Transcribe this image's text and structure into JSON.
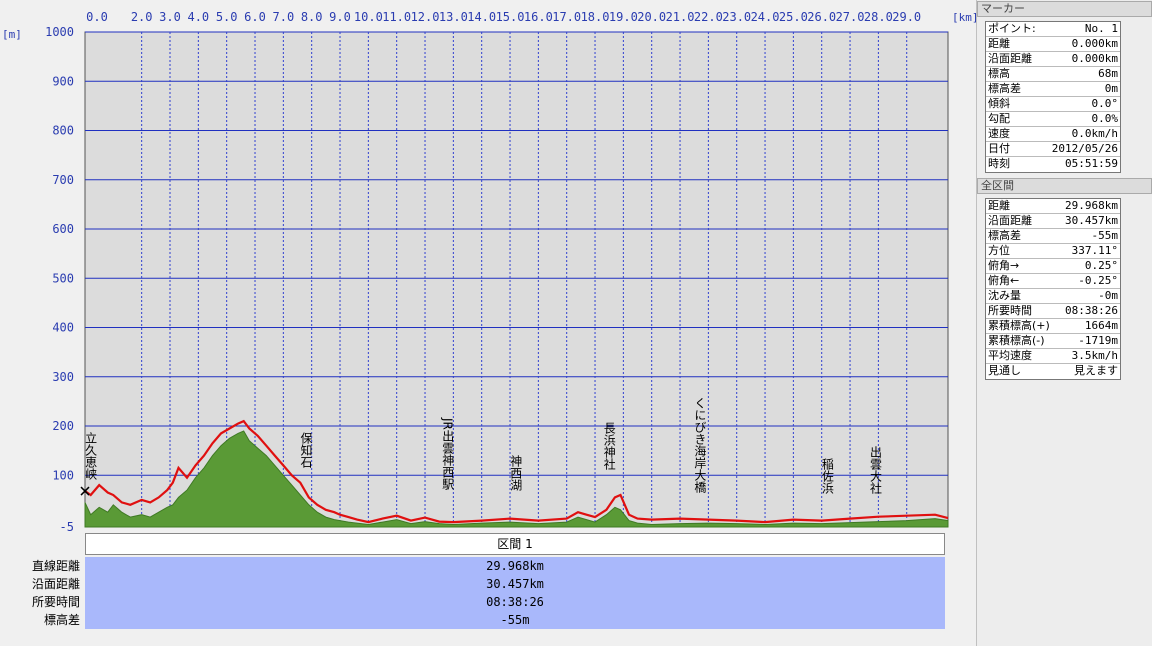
{
  "chart_data": {
    "type": "area",
    "title": "",
    "x_unit": "[km]",
    "y_unit": "[m]",
    "xlim": [
      0,
      30.457
    ],
    "ylim": [
      -5,
      1000
    ],
    "x_ticks": [
      "0.0",
      "2.0",
      "3.0",
      "4.0",
      "5.0",
      "6.0",
      "7.0",
      "8.0",
      "9.0",
      "10.0",
      "11.0",
      "12.0",
      "13.0",
      "14.0",
      "15.0",
      "16.0",
      "17.0",
      "18.0",
      "19.0",
      "20.0",
      "21.0",
      "22.0",
      "23.0",
      "24.0",
      "25.0",
      "26.0",
      "27.0",
      "28.0",
      "29.0"
    ],
    "y_ticks": [
      "1000",
      "900",
      "800",
      "700",
      "600",
      "500",
      "400",
      "300",
      "200",
      "100",
      "-5"
    ],
    "grid": true,
    "series": [
      {
        "color": "#5a9a36",
        "x": [
          0.0,
          0.2,
          0.5,
          0.8,
          1.0,
          1.3,
          1.6,
          2.0,
          2.3,
          2.6,
          2.9,
          3.1,
          3.3,
          3.6,
          3.9,
          4.2,
          4.5,
          4.8,
          5.1,
          5.4,
          5.6,
          5.8,
          6.1,
          6.4,
          6.7,
          7.0,
          7.3,
          7.6,
          7.9,
          8.2,
          8.5,
          8.8,
          9.0,
          9.3,
          9.6,
          10.0,
          10.5,
          11.0,
          11.5,
          12.0,
          12.5,
          13.0,
          14.0,
          15.0,
          16.0,
          17.0,
          17.4,
          17.7,
          18.0,
          18.4,
          18.7,
          18.9,
          19.2,
          19.5,
          20.0,
          21.0,
          22.0,
          23.0,
          24.0,
          25.0,
          26.0,
          27.0,
          28.0,
          29.0,
          30.0,
          30.457
        ],
        "y": [
          45,
          20,
          35,
          25,
          40,
          25,
          15,
          20,
          15,
          25,
          35,
          40,
          55,
          70,
          95,
          115,
          140,
          160,
          175,
          185,
          190,
          170,
          155,
          140,
          120,
          100,
          80,
          60,
          40,
          25,
          15,
          10,
          8,
          5,
          3,
          0,
          5,
          10,
          2,
          6,
          2,
          0,
          3,
          5,
          2,
          5,
          15,
          10,
          5,
          20,
          35,
          30,
          8,
          3,
          0,
          2,
          3,
          2,
          0,
          3,
          2,
          4,
          6,
          8,
          12,
          8
        ]
      },
      {
        "color": "#e01010",
        "x": [
          0.0,
          0.2,
          0.5,
          0.8,
          1.0,
          1.3,
          1.6,
          2.0,
          2.3,
          2.6,
          2.9,
          3.1,
          3.3,
          3.6,
          3.9,
          4.2,
          4.5,
          4.8,
          5.1,
          5.4,
          5.6,
          5.8,
          6.1,
          6.4,
          6.7,
          7.0,
          7.3,
          7.6,
          7.9,
          8.2,
          8.5,
          8.8,
          9.0,
          9.3,
          9.6,
          10.0,
          10.5,
          11.0,
          11.5,
          12.0,
          12.5,
          13.0,
          14.0,
          15.0,
          16.0,
          17.0,
          17.4,
          17.7,
          18.0,
          18.4,
          18.7,
          18.9,
          19.2,
          19.5,
          20.0,
          21.0,
          22.0,
          23.0,
          24.0,
          25.0,
          26.0,
          27.0,
          28.0,
          29.0,
          30.0,
          30.457
        ],
        "y": [
          68,
          60,
          80,
          65,
          60,
          45,
          40,
          50,
          45,
          55,
          70,
          85,
          115,
          95,
          120,
          140,
          165,
          185,
          195,
          205,
          210,
          195,
          180,
          160,
          140,
          120,
          100,
          85,
          55,
          40,
          30,
          25,
          20,
          15,
          10,
          5,
          12,
          18,
          8,
          14,
          6,
          5,
          8,
          12,
          8,
          12,
          25,
          20,
          15,
          30,
          55,
          60,
          20,
          12,
          10,
          12,
          10,
          8,
          5,
          10,
          8,
          12,
          16,
          18,
          20,
          13
        ]
      }
    ],
    "annotations": [
      "立久恵峡",
      "保知石",
      "JR出雲神西駅",
      "神西湖",
      "長浜神社",
      "くにびき海岸大橋",
      "稲佐浜",
      "出雲大社"
    ],
    "summary": {
      "section_label": "区間 1",
      "rows": [
        {
          "label": "直線距離",
          "value": "29.968km"
        },
        {
          "label": "沿面距離",
          "value": "30.457km"
        },
        {
          "label": "所要時間",
          "value": "08:38:26"
        },
        {
          "label": "標高差",
          "value": "-55m"
        }
      ]
    }
  },
  "side_panel": {
    "marker_title": "マーカー",
    "marker_rows": [
      {
        "key": "ポイント:",
        "value": "No. 1"
      },
      {
        "key": "距離",
        "value": "0.000km"
      },
      {
        "key": "沿面距離",
        "value": "0.000km"
      },
      {
        "key": "標高",
        "value": "68m"
      },
      {
        "key": "標高差",
        "value": "0m"
      },
      {
        "key": "傾斜",
        "value": "0.0°"
      },
      {
        "key": "勾配",
        "value": "0.0%"
      },
      {
        "key": "速度",
        "value": "0.0km/h"
      },
      {
        "key": "日付",
        "value": "2012/05/26"
      },
      {
        "key": "時刻",
        "value": "05:51:59"
      }
    ],
    "section_title": "全区間",
    "section_rows": [
      {
        "key": "距離",
        "value": "29.968km"
      },
      {
        "key": "沿面距離",
        "value": "30.457km"
      },
      {
        "key": "標高差",
        "value": "-55m"
      },
      {
        "key": "方位",
        "value": "337.11°"
      },
      {
        "key": "俯角→",
        "value": "0.25°"
      },
      {
        "key": "俯角←",
        "value": "-0.25°"
      },
      {
        "key": "沈み量",
        "value": "-0m"
      },
      {
        "key": "所要時間",
        "value": "08:38:26"
      },
      {
        "key": "累積標高(+)",
        "value": "1664m"
      },
      {
        "key": "累積標高(-)",
        "value": "-1719m"
      },
      {
        "key": "平均速度",
        "value": "3.5km/h"
      },
      {
        "key": "見通し",
        "value": "見えます"
      }
    ]
  }
}
